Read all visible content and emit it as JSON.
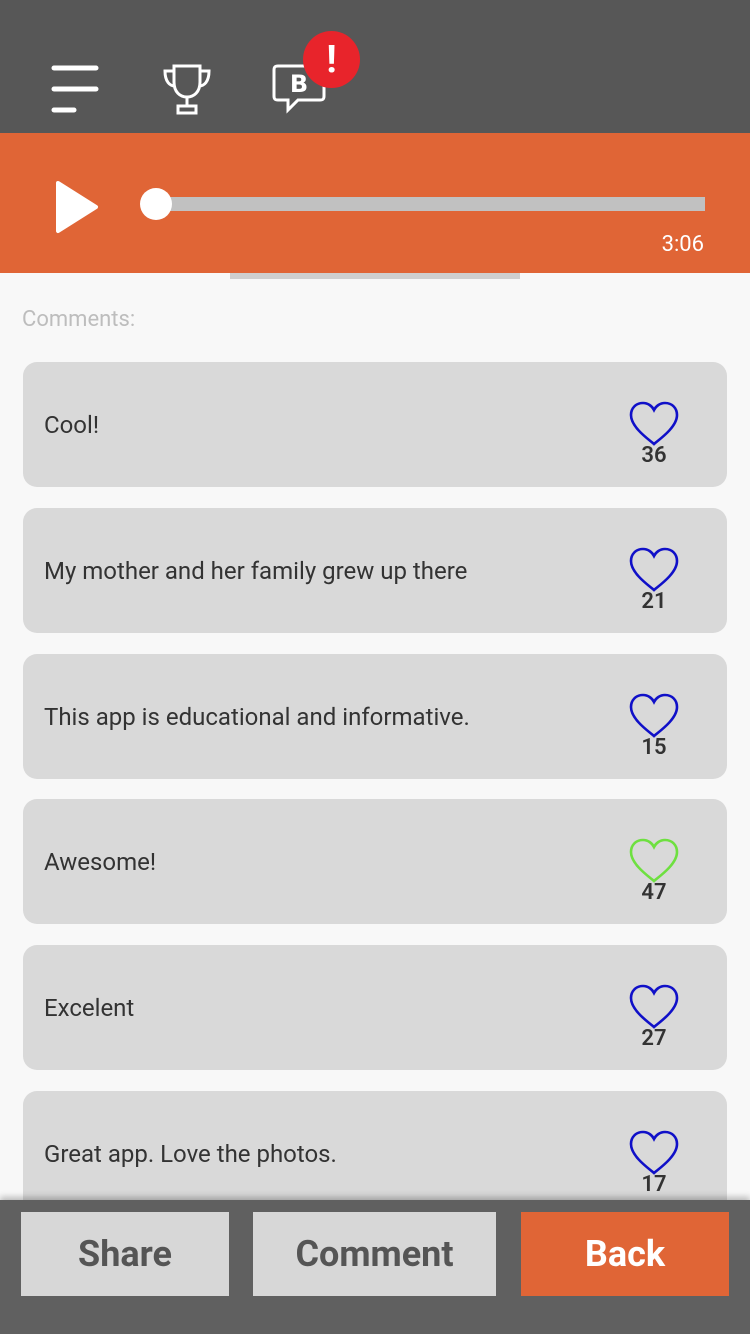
{
  "header": {
    "icons": [
      "menu-icon",
      "trophy-icon",
      "badge-chat-icon"
    ],
    "badge_letter": "B",
    "alert_symbol": "!"
  },
  "player": {
    "time": "3:06",
    "progress": 0.01,
    "accent_color": "#e06536"
  },
  "comments_label": "Comments:",
  "comments": [
    {
      "text": "Cool!",
      "likes": "36",
      "liked": false
    },
    {
      "text": "My mother and her family grew up there",
      "likes": "21",
      "liked": false
    },
    {
      "text": "This app is educational and informative.",
      "likes": "15",
      "liked": false
    },
    {
      "text": "Awesome!",
      "likes": "47",
      "liked": true
    },
    {
      "text": "Excelent",
      "likes": "27",
      "liked": false
    },
    {
      "text": "Great app. Love the photos.",
      "likes": "17",
      "liked": false
    }
  ],
  "colors": {
    "heart_default": "#1010c8",
    "heart_liked": "#6ee040"
  },
  "bottom": {
    "share_label": "Share",
    "comment_label": "Comment",
    "back_label": "Back"
  }
}
